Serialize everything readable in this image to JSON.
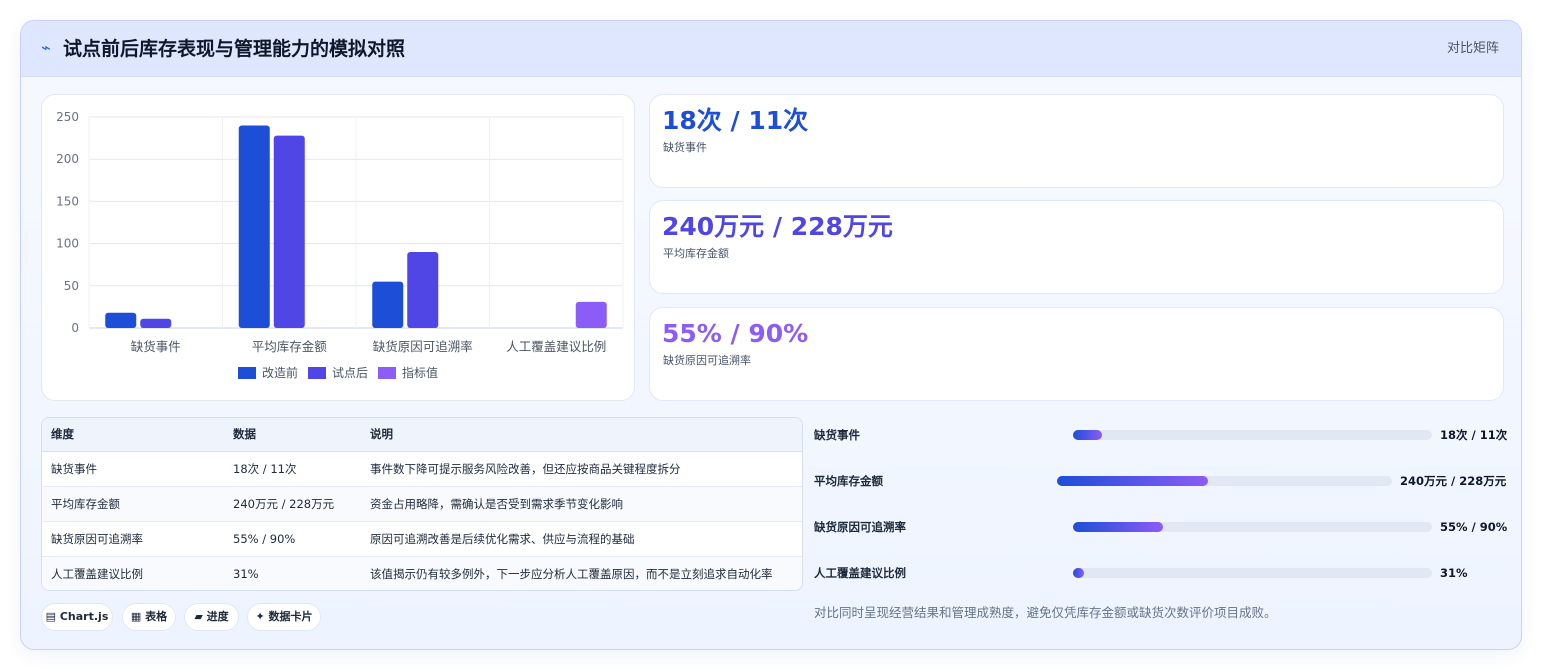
{
  "header": {
    "icon": "pulse-icon",
    "title": "试点前后库存表现与管理能力的模拟对照",
    "right_label": "对比矩阵"
  },
  "chart_data": {
    "type": "bar",
    "categories": [
      "缺货事件",
      "平均库存金额",
      "缺货原因可追溯率",
      "人工覆盖建议比例"
    ],
    "series": [
      {
        "name": "改造前",
        "color": "#1d4ed8",
        "values": [
          18,
          240,
          55,
          null
        ]
      },
      {
        "name": "试点后",
        "color": "#4f46e5",
        "values": [
          11,
          228,
          90,
          null
        ]
      },
      {
        "name": "指标值",
        "color": "#8b5cf6",
        "values": [
          null,
          null,
          null,
          31
        ]
      }
    ],
    "yticks": [
      "0",
      "50",
      "100",
      "150",
      "200",
      "250"
    ],
    "ylim": [
      0,
      250
    ],
    "legend_position": "bottom",
    "grid": true
  },
  "stats": [
    {
      "value": "18次 / 11次",
      "label": "缺货事件",
      "color": "#1d4ed8"
    },
    {
      "value": "240万元 / 228万元",
      "label": "平均库存金额",
      "color": "#4f46e5"
    },
    {
      "value": "55% / 90%",
      "label": "缺货原因可追溯率",
      "color": "#8b5cf6"
    }
  ],
  "table": {
    "headers": [
      "维度",
      "数据",
      "说明"
    ],
    "rows": [
      [
        "缺货事件",
        "18次 / 11次",
        "事件数下降可提示服务风险改善，但还应按商品关键程度拆分"
      ],
      [
        "平均库存金额",
        "240万元 / 228万元",
        "资金占用略降，需确认是否受到需求季节变化影响"
      ],
      [
        "缺货原因可追溯率",
        "55% / 90%",
        "原因可追溯改善是后续优化需求、供应与流程的基础"
      ],
      [
        "人工覆盖建议比例",
        "31%",
        "该值揭示仍有较多例外，下一步应分析人工覆盖原因，而不是立刻追求自动化率"
      ]
    ]
  },
  "tags": [
    {
      "icon": "▤",
      "label": "Chart.js"
    },
    {
      "icon": "▦",
      "label": "表格"
    },
    {
      "icon": "▰",
      "label": "进度"
    },
    {
      "icon": "✦",
      "label": "数据卡片"
    }
  ],
  "progress": [
    {
      "label": "缺货事件",
      "value": "18次 / 11次",
      "fill": 0.08
    },
    {
      "label": "平均库存金额",
      "value": "240万元 / 228万元",
      "fill": 0.45
    },
    {
      "label": "缺货原因可追溯率",
      "value": "55% / 90%",
      "fill": 0.25
    },
    {
      "label": "人工覆盖建议比例",
      "value": "31%",
      "fill": 0.03
    }
  ],
  "footnote": "对比同时呈现经营结果和管理成熟度，避免仅凭库存金额或缺货次数评价项目成败。"
}
